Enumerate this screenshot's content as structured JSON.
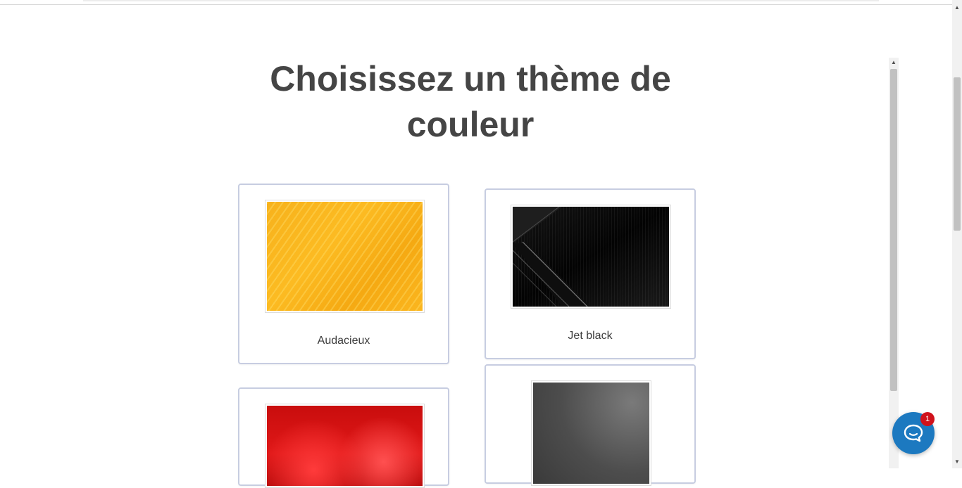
{
  "title": "Choisissez un thème de couleur",
  "themes": [
    {
      "label": "Audacieux",
      "thumbnail": "yellow-diagonal-lines"
    },
    {
      "label": "Jet black",
      "thumbnail": "black-diagonal-stripes"
    },
    {
      "label": "",
      "thumbnail": "red-bokeh"
    },
    {
      "label": "",
      "thumbnail": "grey-gradient"
    }
  ],
  "chat": {
    "icon": "chat-bubble-icon",
    "badge_count": "1"
  },
  "colors": {
    "accent": "#1c79c0",
    "badge": "#d0121b",
    "card_border": "#c7cde1",
    "title": "#454545"
  }
}
